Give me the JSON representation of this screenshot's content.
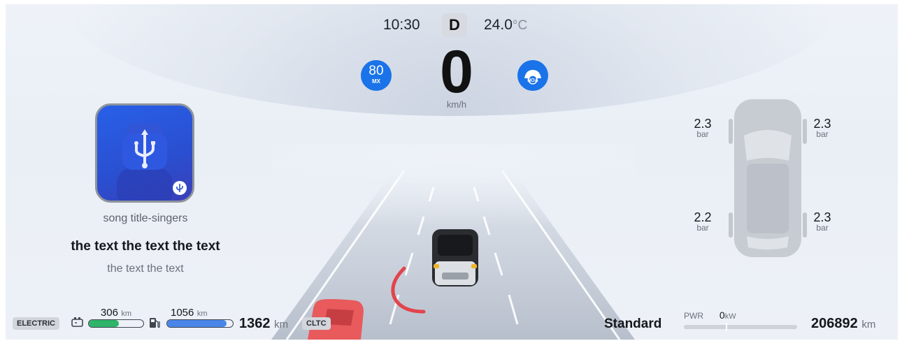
{
  "status": {
    "time": "10:30",
    "gear": "D",
    "temperature": "24.0",
    "temperature_unit": "°C"
  },
  "speedometer": {
    "speed": "0",
    "unit": "km/h",
    "speed_limit": "80",
    "speed_limit_sub": "MX",
    "noa_label": "NOA"
  },
  "media": {
    "song": "song title-singers",
    "lyric_primary": "the text the text the text",
    "lyric_secondary": "the text the text"
  },
  "tires": {
    "front_left": {
      "pressure": "2.3",
      "unit": "bar"
    },
    "front_right": {
      "pressure": "2.3",
      "unit": "bar"
    },
    "rear_left": {
      "pressure": "2.2",
      "unit": "bar"
    },
    "rear_right": {
      "pressure": "2.3",
      "unit": "bar"
    }
  },
  "energy": {
    "mode_tag": "ELECTRIC",
    "battery_range": "306",
    "battery_unit": "km",
    "battery_level": 0.55,
    "battery_color": "#2fb46a",
    "fuel_range": "1056",
    "fuel_unit": "km",
    "fuel_level": 0.9,
    "fuel_color": "#4a86e8",
    "total_range": "1362",
    "total_unit": "km",
    "standard_tag": "CLTC"
  },
  "drive": {
    "mode": "Standard",
    "pwr_label": "PWR",
    "pwr_value": "0",
    "pwr_unit": "kW"
  },
  "odometer": {
    "value": "206892",
    "unit": "km"
  },
  "colors": {
    "accent_blue": "#1a73e8",
    "warning_red": "#e2444c",
    "lead_car_red": "#e85a5c"
  }
}
